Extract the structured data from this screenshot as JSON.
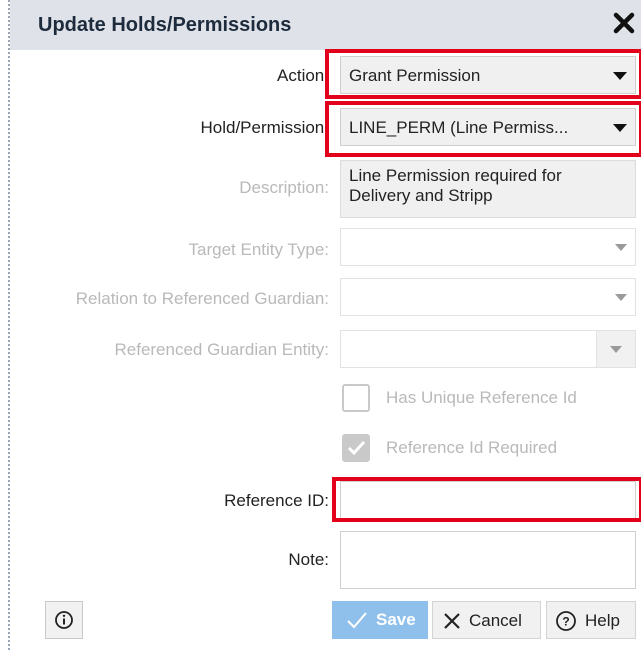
{
  "dialog": {
    "title": "Update Holds/Permissions"
  },
  "form": {
    "action": {
      "label": "Action:",
      "value": "Grant Permission"
    },
    "hold_permission": {
      "label": "Hold/Permission:",
      "value": "LINE_PERM (Line Permiss..."
    },
    "description": {
      "label": "Description:",
      "value": "Line Permission required for Delivery and Stripp"
    },
    "target_entity_type": {
      "label": "Target Entity Type:",
      "value": ""
    },
    "relation_to_guardian": {
      "label": "Relation to Referenced Guardian:",
      "value": ""
    },
    "referenced_guardian_entity": {
      "label": "Referenced Guardian Entity:",
      "value": ""
    },
    "has_unique_reference_id": {
      "label": "Has Unique Reference Id",
      "checked": false
    },
    "reference_id_required": {
      "label": "Reference Id Required",
      "checked": true
    },
    "reference_id": {
      "label": "Reference ID:",
      "value": ""
    },
    "note": {
      "label": "Note:",
      "value": ""
    }
  },
  "footer": {
    "save_label": "Save",
    "cancel_label": "Cancel",
    "help_label": "Help"
  },
  "colors": {
    "highlight": "#e2001a",
    "save_button": "#8fc0ec",
    "title_bar": "#dfe3e9"
  },
  "icons": [
    "close-icon",
    "chevron-down-icon",
    "checkmark-icon",
    "x-icon",
    "question-icon",
    "info-icon"
  ]
}
